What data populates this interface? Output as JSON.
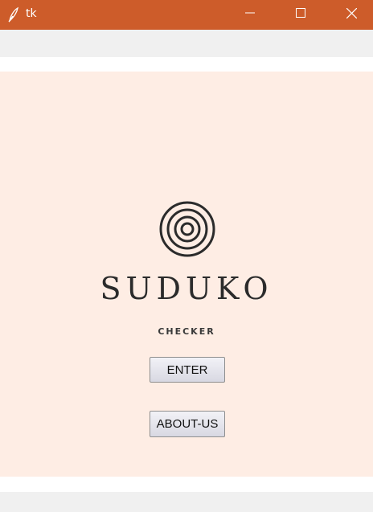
{
  "window": {
    "title": "tk",
    "icon": "feather-icon",
    "controls": [
      "minimize-icon",
      "maximize-icon",
      "close-icon"
    ]
  },
  "logo": {
    "icon": "concentric-rings-icon",
    "title": "SUDUKO",
    "subtitle": "CHECKER"
  },
  "buttons": {
    "enter": "ENTER",
    "about": "ABOUT-US"
  },
  "colors": {
    "titlebar": "#cd5c2a",
    "canvas": "#feede4",
    "text": "#2b2b2b"
  }
}
